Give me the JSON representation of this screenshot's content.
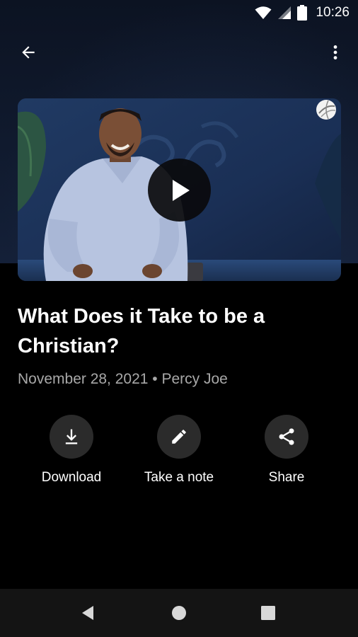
{
  "status_bar": {
    "time": "10:26",
    "icons": [
      "wifi-icon",
      "signal-icon",
      "battery-icon"
    ]
  },
  "app_bar": {
    "back_icon": "arrow-left-icon",
    "menu_icon": "more-vertical-icon"
  },
  "video": {
    "play_icon": "play-icon",
    "badge_icon": "globe-icon"
  },
  "sermon": {
    "title": "What Does it Take to be a Christian?",
    "meta": "November 28, 2021 • Percy Joe"
  },
  "actions": [
    {
      "label": "Download",
      "icon": "download-icon"
    },
    {
      "label": "Take a note",
      "icon": "pencil-icon"
    },
    {
      "label": "Share",
      "icon": "share-icon"
    }
  ],
  "colors": {
    "background": "#000000",
    "action_circle": "#2b2b2b",
    "meta_text": "#a8a8a8",
    "nav_bar": "#141414"
  }
}
